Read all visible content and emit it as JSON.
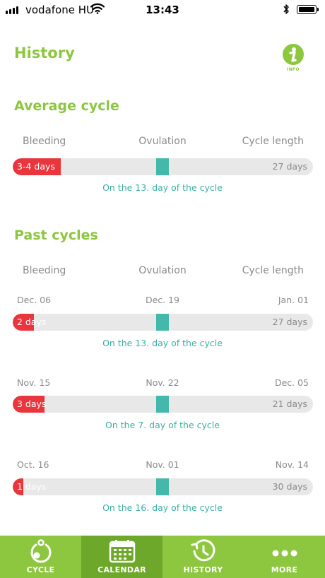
{
  "status_bar": {
    "carrier": "vodafone HU",
    "time": "13:43"
  },
  "header": {
    "title": "History",
    "info_label": "INFO"
  },
  "average_cycle": {
    "title": "Average cycle",
    "columns": {
      "bleeding": "Bleeding",
      "ovulation": "Ovulation",
      "cycle_length": "Cycle length"
    },
    "bleeding_label": "3-4 days",
    "cycle_length_label": "27 days",
    "ovulation_note": "On the 13. day of the cycle"
  },
  "past_cycles": {
    "title": "Past cycles",
    "columns": {
      "bleeding": "Bleeding",
      "ovulation": "Ovulation",
      "cycle_length": "Cycle length"
    },
    "cycles": [
      {
        "start": "Dec. 06",
        "ovulation_date": "Dec. 19",
        "end": "Jan. 01",
        "bleeding_label": "2 days",
        "cycle_length_label": "27 days",
        "ovulation_note": "On the 13. day of the cycle"
      },
      {
        "start": "Nov. 15",
        "ovulation_date": "Nov. 22",
        "end": "Dec. 05",
        "bleeding_label": "3 days",
        "cycle_length_label": "21 days",
        "ovulation_note": "On the 7. day of the cycle"
      },
      {
        "start": "Oct. 16",
        "ovulation_date": "Nov. 01",
        "end": "Nov. 14",
        "bleeding_label": "1 days",
        "cycle_length_label": "30 days",
        "ovulation_note": "On the 16. day of the cycle"
      }
    ]
  },
  "tabbar": {
    "active": "calendar",
    "tabs": [
      {
        "id": "cycle",
        "label": "CYCLE",
        "icon": "cycle-icon"
      },
      {
        "id": "calendar",
        "label": "CALENDAR",
        "icon": "calendar-icon"
      },
      {
        "id": "history",
        "label": "HISTORY",
        "icon": "history-icon"
      },
      {
        "id": "more",
        "label": "MORE",
        "icon": "more-icon"
      }
    ]
  },
  "colors": {
    "brand_green": "#8dc63f",
    "active_tab": "#6ea82a",
    "bleeding_red": "#e8363c",
    "ovulation_teal": "#45b8ac",
    "track_gray": "#e8e8e8"
  }
}
